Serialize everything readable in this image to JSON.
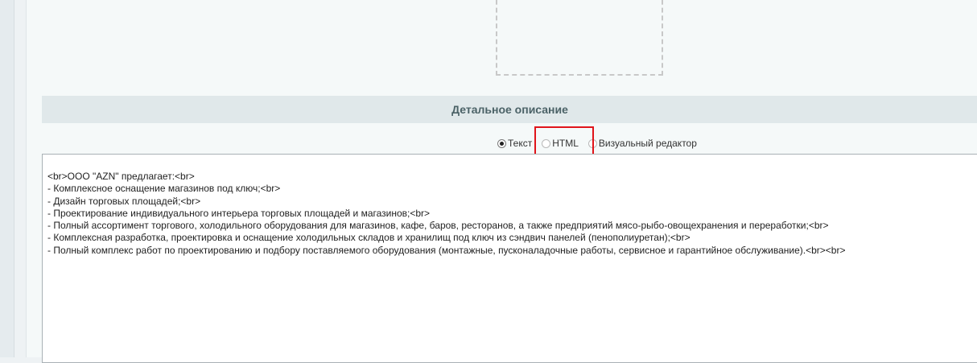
{
  "detail": {
    "section_title": "Детальное описание",
    "modes": {
      "text_label": "Текст",
      "html_label": "HTML",
      "visual_label": "Визуальный редактор",
      "selected": "text"
    },
    "editor": {
      "content": "<br>ООО \"AZN\" предлагает:<br>\n- Комплексное оснащение магазинов под ключ;<br>\n- Дизайн торговых площадей;<br>\n- Проектирование индивидуального интерьера торговых площадей и магазинов;<br>\n- Полный ассортимент торгового, холодильного оборудования для магазинов, кафе, баров, ресторанов, а также предприятий мясо-рыбо-овощехранения и переработки;<br>\n- Комплексная разработка, проектировка и оснащение холодильных складов и хранилищ под ключ из сэндвич панелей (пенополиуретан);<br>\n- Полный комплекс работ по проектированию и подбору поставляемого оборудования (монтажные, пусконаладочные работы, сервисное и гарантийное обслуживание).<br><br>"
    }
  },
  "colors": {
    "highlight": "#e0141a",
    "header_bg": "#e0e8ea",
    "header_text": "#4b6267"
  }
}
